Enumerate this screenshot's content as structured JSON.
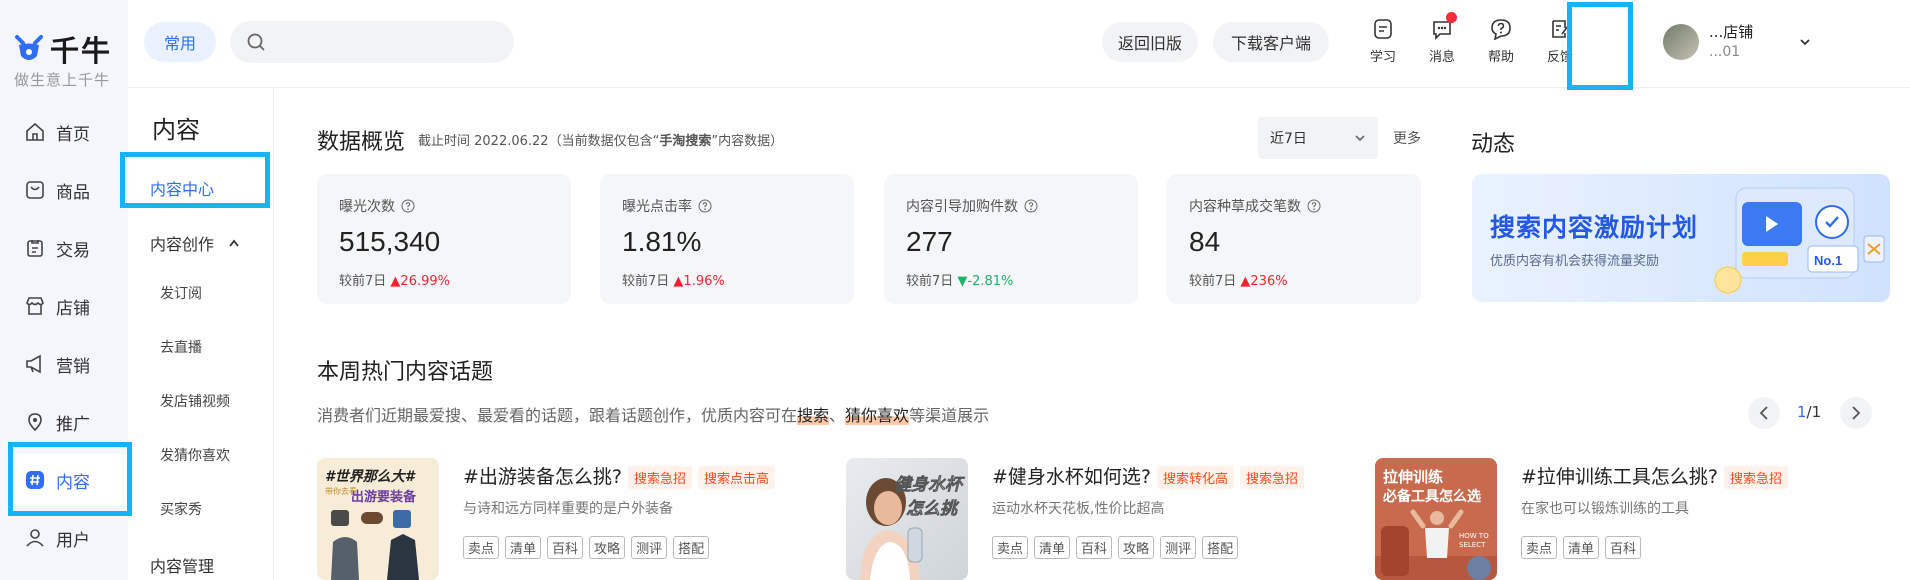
{
  "brand": {
    "name": "千牛",
    "slogan": "做生意上千牛"
  },
  "left_nav": [
    {
      "label": "首页",
      "icon": "home-icon"
    },
    {
      "label": "商品",
      "icon": "product-icon"
    },
    {
      "label": "交易",
      "icon": "trade-icon"
    },
    {
      "label": "店铺",
      "icon": "shop-icon"
    },
    {
      "label": "营销",
      "icon": "marketing-icon"
    },
    {
      "label": "推广",
      "icon": "promotion-icon"
    },
    {
      "label": "内容",
      "icon": "content-icon",
      "active": true
    },
    {
      "label": "用户",
      "icon": "user-icon"
    }
  ],
  "sub_nav": {
    "title": "内容",
    "center": "内容中心",
    "creation": "内容创作",
    "leaves": [
      "发订阅",
      "去直播",
      "发店铺视频",
      "发猜你喜欢",
      "买家秀"
    ],
    "manage": "内容管理"
  },
  "header": {
    "common_label": "常用",
    "search_placeholder": "",
    "back_old": "返回旧版",
    "download_client": "下载客户端",
    "icons": [
      {
        "label": "学习",
        "icon": "learn-icon"
      },
      {
        "label": "消息",
        "icon": "message-icon",
        "badge": true
      },
      {
        "label": "帮助",
        "icon": "help-icon"
      },
      {
        "label": "反馈",
        "icon": "feedback-icon"
      }
    ],
    "account": {
      "name": "...店铺",
      "id": "...01"
    }
  },
  "overview": {
    "title": "数据概览",
    "note_prefix": "截止时间 2022.06.22（当前数据仅包含“",
    "note_bold": "手淘搜索",
    "note_suffix": "”内容数据）",
    "range_select": "近7日",
    "more": "更多",
    "cards": [
      {
        "label": "曝光次数",
        "value": "515,340",
        "cmp_label": "较前7日",
        "trend": "up",
        "delta": "26.99%"
      },
      {
        "label": "曝光点击率",
        "value": "1.81%",
        "cmp_label": "较前7日",
        "trend": "up",
        "delta": "1.96%"
      },
      {
        "label": "内容引导加购件数",
        "value": "277",
        "cmp_label": "较前7日",
        "trend": "down",
        "delta": "-2.81%"
      },
      {
        "label": "内容种草成交笔数",
        "value": "84",
        "cmp_label": "较前7日",
        "trend": "up",
        "delta": "236%"
      }
    ]
  },
  "dynamics": {
    "title": "动态",
    "banner_title": "搜索内容激励计划",
    "banner_sub": "优质内容有机会获得流量奖励",
    "banner_badge": "No.1"
  },
  "hot_topics": {
    "title": "本周热门内容话题",
    "desc_prefix": "消费者们近期最爱搜、最爱看的话题，跟着话题创作，优质内容可在",
    "desc_kw1": "搜索",
    "desc_sep": "、",
    "desc_kw2": "猜你喜欢",
    "desc_suffix": "等渠道展示",
    "page_current": "1",
    "page_total": "/1",
    "items": [
      {
        "title": "#出游装备怎么挑?",
        "tags": [
          "搜索急招",
          "搜索点击高"
        ],
        "desc": "与诗和远方同样重要的是户外装备",
        "chips": [
          "卖点",
          "清单",
          "百科",
          "攻略",
          "测评",
          "搭配"
        ],
        "thumb_text1": "#世界那么大#",
        "thumb_text2": "出游要装备",
        "thumb_text3": "带你去看"
      },
      {
        "title": "#健身水杯如何选?",
        "tags": [
          "搜索转化高",
          "搜索急招"
        ],
        "desc": "运动水杯天花板,性价比超高",
        "chips": [
          "卖点",
          "清单",
          "百科",
          "攻略",
          "测评",
          "搭配"
        ],
        "thumb_text1": "健身水杯",
        "thumb_text2": "怎么挑"
      },
      {
        "title": "#拉伸训练工具怎么挑?",
        "tags": [
          "搜索急招"
        ],
        "desc": "在家也可以锻炼训练的工具",
        "chips": [
          "卖点",
          "清单",
          "百科"
        ],
        "thumb_text1": "拉伸训练",
        "thumb_text2": "必备工具怎么选",
        "thumb_text3": "HOW TO SELECT"
      }
    ]
  },
  "colors": {
    "accent": "#2f6ef5",
    "highlight": "#17b3f5",
    "up": "#f5222d",
    "down": "#1fb16b",
    "tag": "#ff4a1a"
  }
}
